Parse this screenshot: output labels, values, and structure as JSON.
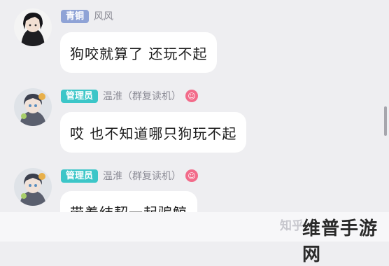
{
  "messages": [
    {
      "badge": "青铜",
      "badge_color": "#8fa3d6",
      "name": "风风",
      "has_emoji_badge": false,
      "text": "狗咬就算了 还玩不起"
    },
    {
      "badge": "管理员",
      "badge_color": "#3cc6c8",
      "name": "温淮（群复读机）",
      "has_emoji_badge": true,
      "text": "哎 也不知道哪只狗玩不起"
    },
    {
      "badge": "管理员",
      "badge_color": "#3cc6c8",
      "name": "温淮（群复读机）",
      "has_emoji_badge": true,
      "text": "带着结契一起骗鲸"
    }
  ],
  "emoji_badge_glyph": "☺",
  "watermark": {
    "zhihu": "知乎",
    "site": "维普手游网"
  }
}
